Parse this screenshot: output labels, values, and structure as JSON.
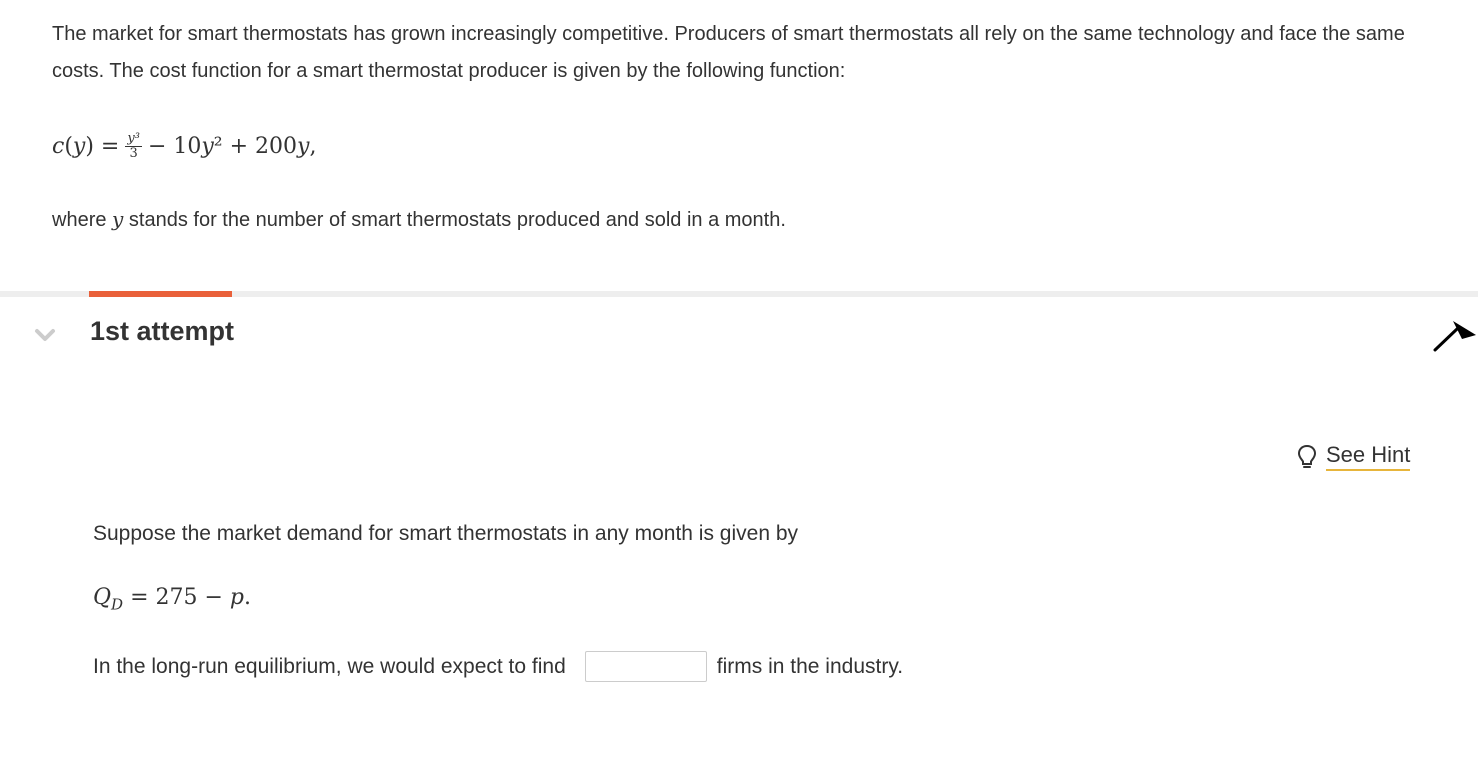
{
  "intro": {
    "text": "The market for smart thermostats has grown increasingly competitive. Producers of smart thermostats all rely on the same technology and face the same costs. The cost function for a smart thermostat producer is given by the following function:"
  },
  "cost_function": {
    "lhs_c": "c",
    "lhs_open": " (",
    "lhs_var": "y",
    "lhs_close": ") =",
    "frac_num": "y³",
    "frac_den": "3",
    "rest_a": "− 10",
    "rest_var1": "y",
    "rest_b": "² + 200",
    "rest_var2": "y",
    "rest_c": ","
  },
  "where": {
    "pre": "where ",
    "var": "y",
    "post": " stands for the number of smart thermostats produced and sold in a month."
  },
  "attempt": {
    "title": "1st attempt"
  },
  "hint": {
    "label": "See Hint",
    "icon": "lightbulb-icon"
  },
  "question": {
    "text": "Suppose the market demand for smart thermostats in any month is given by"
  },
  "demand": {
    "q": "Q",
    "sub": "D",
    "middle": " = 275 − ",
    "p": "p",
    "end": "."
  },
  "answer": {
    "before": "In the long-run equilibrium, we would expect to find",
    "value": "",
    "after": "firms in the industry."
  },
  "colors": {
    "accent": "#e9603a",
    "hint_underline": "#e7b53b",
    "divider": "#eeeeee",
    "text": "#333333"
  }
}
